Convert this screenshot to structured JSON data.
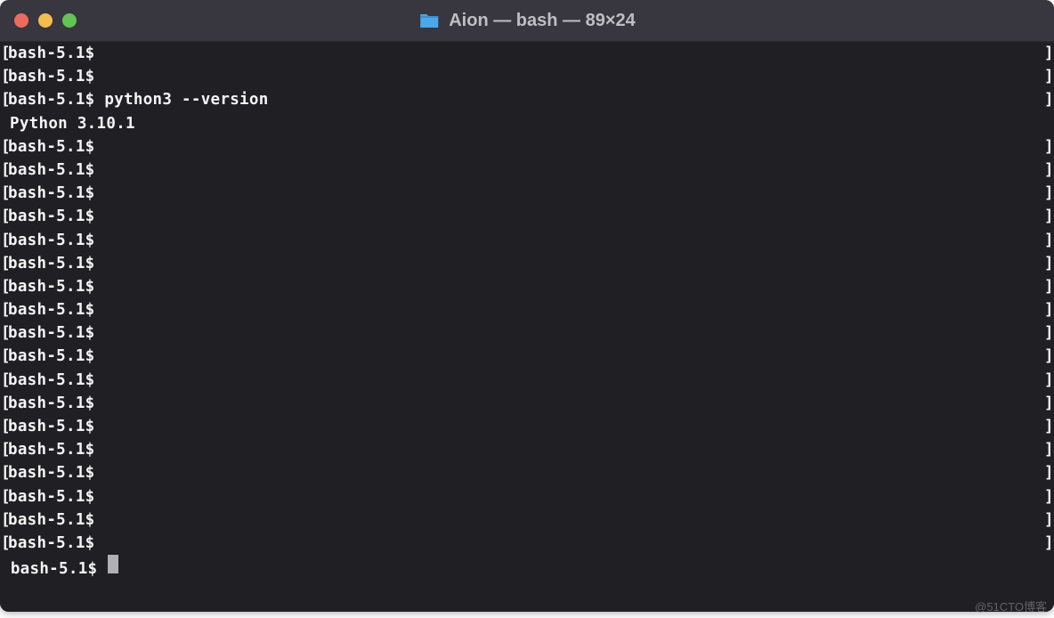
{
  "titlebar": {
    "title": "Aion — bash — 89×24",
    "icon": "folder-icon"
  },
  "terminal": {
    "prompt": "bash-5.1$",
    "lbracket": "[",
    "rbracket": "]",
    "lines": [
      {
        "type": "prompt",
        "cmd": ""
      },
      {
        "type": "prompt",
        "cmd": ""
      },
      {
        "type": "prompt",
        "cmd": "python3 --version"
      },
      {
        "type": "output",
        "text": "Python 3.10.1"
      },
      {
        "type": "prompt",
        "cmd": ""
      },
      {
        "type": "prompt",
        "cmd": ""
      },
      {
        "type": "prompt",
        "cmd": ""
      },
      {
        "type": "prompt",
        "cmd": ""
      },
      {
        "type": "prompt",
        "cmd": ""
      },
      {
        "type": "prompt",
        "cmd": ""
      },
      {
        "type": "prompt",
        "cmd": ""
      },
      {
        "type": "prompt",
        "cmd": ""
      },
      {
        "type": "prompt",
        "cmd": ""
      },
      {
        "type": "prompt",
        "cmd": ""
      },
      {
        "type": "prompt",
        "cmd": ""
      },
      {
        "type": "prompt",
        "cmd": ""
      },
      {
        "type": "prompt",
        "cmd": ""
      },
      {
        "type": "prompt",
        "cmd": ""
      },
      {
        "type": "prompt",
        "cmd": ""
      },
      {
        "type": "prompt",
        "cmd": ""
      },
      {
        "type": "prompt",
        "cmd": ""
      },
      {
        "type": "prompt",
        "cmd": ""
      },
      {
        "type": "cursor",
        "cmd": ""
      }
    ]
  },
  "watermark": "@51CTO博客"
}
